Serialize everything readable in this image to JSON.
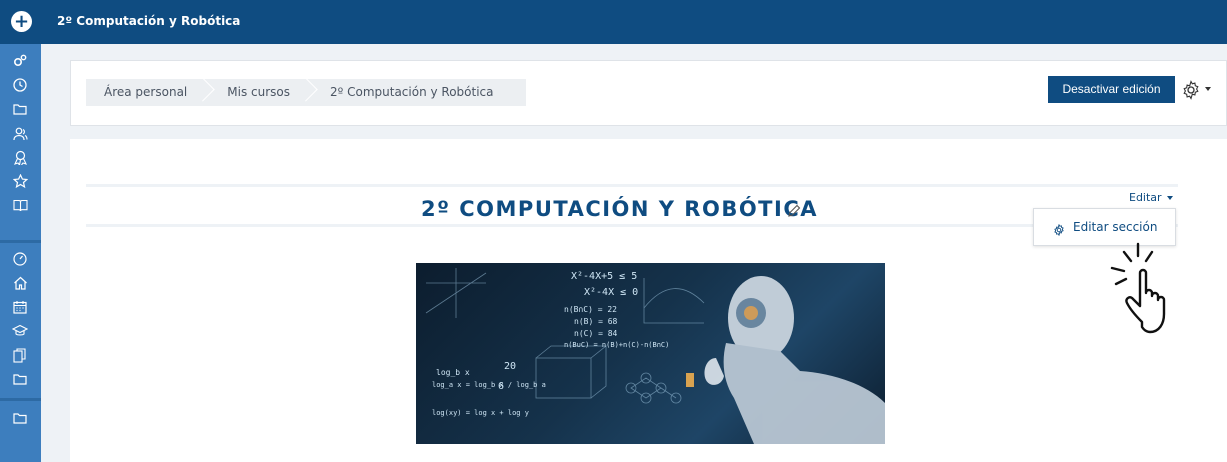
{
  "topbar": {
    "add_icon": "plus-circle-icon",
    "title": "2º Computación y Robótica"
  },
  "sidebar": {
    "items": [
      {
        "icon": "cogs-icon"
      },
      {
        "icon": "clock-icon"
      },
      {
        "icon": "folder-icon"
      },
      {
        "icon": "users-icon"
      },
      {
        "icon": "badge-icon"
      },
      {
        "icon": "star-icon"
      },
      {
        "icon": "book-icon"
      },
      {
        "icon": "dashboard-icon"
      },
      {
        "icon": "home-icon"
      },
      {
        "icon": "calendar-icon"
      },
      {
        "icon": "graduation-cap-icon"
      },
      {
        "icon": "files-icon"
      },
      {
        "icon": "folder-icon"
      },
      {
        "icon": "folder-icon"
      }
    ]
  },
  "breadcrumb": {
    "items": [
      "Área personal",
      "Mis cursos",
      "2º Computación y Robótica"
    ]
  },
  "header": {
    "edit_button": "Desactivar edición",
    "settings_icon": "gear-icon"
  },
  "section": {
    "title": "2º COMPUTACIÓN Y ROBÓTICA",
    "edit_menu_label": "Editar",
    "menu": {
      "edit_section": "Editar sección"
    }
  },
  "hero_image": {
    "formulas": [
      "X²-4X+5 ≤ 5",
      "X²-4X ≤ 0",
      "n(B∩C) = 22",
      "n(B) = 68",
      "n(C) = 84",
      "n(B∪C) = n(B)+n(C)-n(B∩C)",
      "log_b x",
      "log_a x = log_b x / log_b a",
      "log(xy) = log x + log y",
      "20",
      "6"
    ]
  },
  "colors": {
    "primary": "#0f4c81",
    "sidebar": "#3d7ebe"
  }
}
